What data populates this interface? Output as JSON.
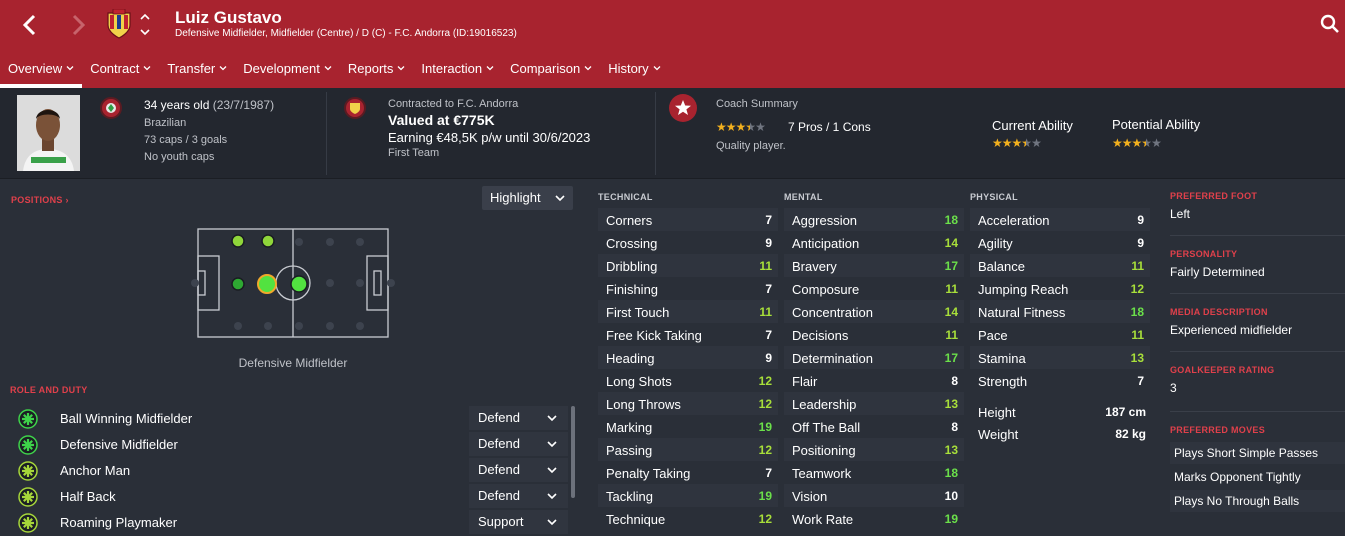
{
  "header": {
    "name": "Luiz Gustavo",
    "subtitle": "Defensive Midfielder, Midfielder (Centre) / D (C) - F.C. Andorra (ID:19016523)",
    "back_icon": "chevron-left-icon",
    "forward_icon": "chevron-right-icon",
    "search_icon": "search-icon",
    "accent": "#a8232f"
  },
  "tabs": [
    {
      "label": "Overview",
      "active": true
    },
    {
      "label": "Contract"
    },
    {
      "label": "Transfer"
    },
    {
      "label": "Development"
    },
    {
      "label": "Reports"
    },
    {
      "label": "Interaction"
    },
    {
      "label": "Comparison"
    },
    {
      "label": "History"
    }
  ],
  "summary": {
    "age": "34 years old",
    "dob": "(23/7/1987)",
    "nationality": "Brazilian",
    "caps": "73 caps / 3 goals",
    "youth": "No youth caps",
    "contracted": "Contracted to F.C. Andorra",
    "value": "Valued at €775K",
    "earning": "Earning €48,5K p/w until 30/6/2023",
    "squad": "First Team",
    "coach_title": "Coach Summary",
    "coach_rating": 3.5,
    "pros_cons": "7 Pros / 1 Cons",
    "quality": "Quality player.",
    "current_ability_label": "Current Ability",
    "current_ability": 3.5,
    "potential_ability_label": "Potential Ability",
    "potential_ability": 3.5
  },
  "positions": {
    "title": "POSITIONS",
    "view_select": "Highlight",
    "label": "Defensive Midfielder"
  },
  "roles": {
    "title": "ROLE AND DUTY",
    "items": [
      {
        "name": "Ball Winning Midfielder",
        "duty": "Defend",
        "rating": "high"
      },
      {
        "name": "Defensive Midfielder",
        "duty": "Defend",
        "rating": "high"
      },
      {
        "name": "Anchor Man",
        "duty": "Defend",
        "rating": "mid"
      },
      {
        "name": "Half Back",
        "duty": "Defend",
        "rating": "mid"
      },
      {
        "name": "Roaming Playmaker",
        "duty": "Support",
        "rating": "mid"
      }
    ]
  },
  "attributes": {
    "technical_title": "TECHNICAL",
    "mental_title": "MENTAL",
    "physical_title": "PHYSICAL",
    "technical": [
      {
        "name": "Corners",
        "value": "7"
      },
      {
        "name": "Crossing",
        "value": "9"
      },
      {
        "name": "Dribbling",
        "value": "11"
      },
      {
        "name": "Finishing",
        "value": "7"
      },
      {
        "name": "First Touch",
        "value": "11"
      },
      {
        "name": "Free Kick Taking",
        "value": "7"
      },
      {
        "name": "Heading",
        "value": "9"
      },
      {
        "name": "Long Shots",
        "value": "12"
      },
      {
        "name": "Long Throws",
        "value": "12"
      },
      {
        "name": "Marking",
        "value": "19"
      },
      {
        "name": "Passing",
        "value": "12"
      },
      {
        "name": "Penalty Taking",
        "value": "7"
      },
      {
        "name": "Tackling",
        "value": "19"
      },
      {
        "name": "Technique",
        "value": "12"
      }
    ],
    "mental": [
      {
        "name": "Aggression",
        "value": "18"
      },
      {
        "name": "Anticipation",
        "value": "14"
      },
      {
        "name": "Bravery",
        "value": "17"
      },
      {
        "name": "Composure",
        "value": "11"
      },
      {
        "name": "Concentration",
        "value": "14"
      },
      {
        "name": "Decisions",
        "value": "11"
      },
      {
        "name": "Determination",
        "value": "17"
      },
      {
        "name": "Flair",
        "value": "8"
      },
      {
        "name": "Leadership",
        "value": "13"
      },
      {
        "name": "Off The Ball",
        "value": "8"
      },
      {
        "name": "Positioning",
        "value": "13"
      },
      {
        "name": "Teamwork",
        "value": "18"
      },
      {
        "name": "Vision",
        "value": "10"
      },
      {
        "name": "Work Rate",
        "value": "19"
      }
    ],
    "physical": [
      {
        "name": "Acceleration",
        "value": "9"
      },
      {
        "name": "Agility",
        "value": "9"
      },
      {
        "name": "Balance",
        "value": "11"
      },
      {
        "name": "Jumping Reach",
        "value": "12"
      },
      {
        "name": "Natural Fitness",
        "value": "18"
      },
      {
        "name": "Pace",
        "value": "11"
      },
      {
        "name": "Stamina",
        "value": "13"
      },
      {
        "name": "Strength",
        "value": "7"
      }
    ],
    "height_label": "Height",
    "height": "187 cm",
    "weight_label": "Weight",
    "weight": "82 kg"
  },
  "info": {
    "foot_title": "PREFERRED FOOT",
    "foot": "Left",
    "personality_title": "PERSONALITY",
    "personality": "Fairly Determined",
    "media_title": "MEDIA DESCRIPTION",
    "media": "Experienced midfielder",
    "gk_title": "GOALKEEPER RATING",
    "gk": "3",
    "moves_title": "PREFERRED MOVES",
    "moves": [
      "Plays Short Simple Passes",
      "Marks Opponent Tightly",
      "Plays No Through Balls"
    ]
  }
}
